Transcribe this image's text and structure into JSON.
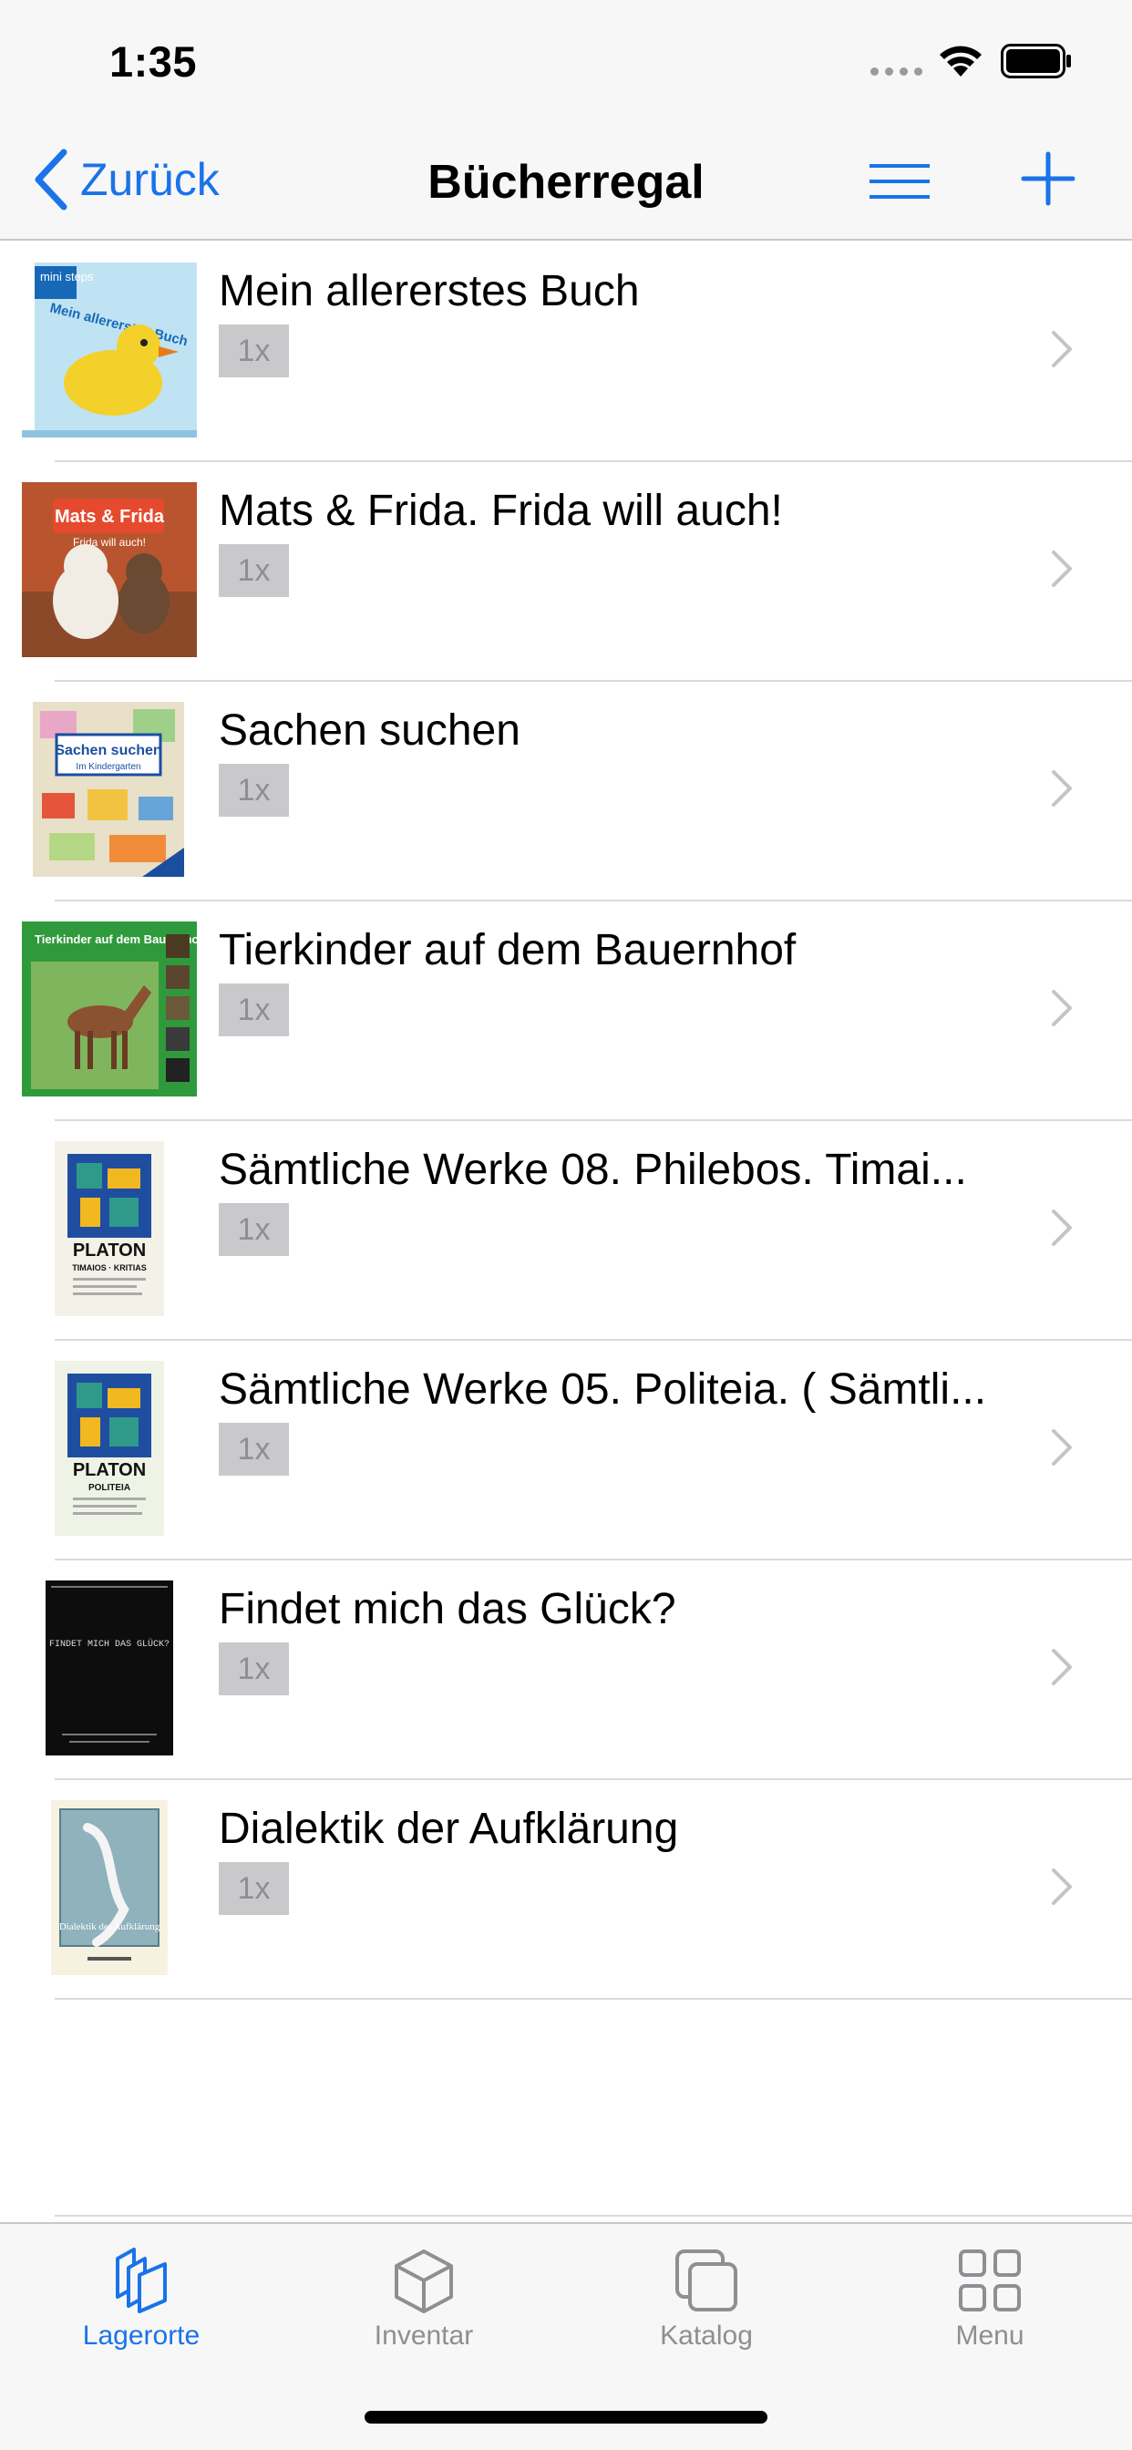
{
  "status_bar": {
    "time": "1:35"
  },
  "nav": {
    "back_label": "Zurück",
    "title": "Bücherregal"
  },
  "books": [
    {
      "title": "Mein allererstes Buch",
      "quantity": "1x",
      "cover_text": "Mein allererstes Buch",
      "cover_badge": "mini steps"
    },
    {
      "title": "Mats & Frida. Frida will auch!",
      "quantity": "1x",
      "cover_text": "Mats & Frida",
      "cover_sub": "Frida will auch!"
    },
    {
      "title": "Sachen suchen",
      "quantity": "1x",
      "cover_text": "Sachen suchen",
      "cover_sub": "Im Kindergarten"
    },
    {
      "title": "Tierkinder auf dem Bauernhof",
      "quantity": "1x",
      "cover_text": "Tierkinder auf dem Bauernhof"
    },
    {
      "title": "Sämtliche Werke 08. Philebos. Timai...",
      "quantity": "1x",
      "cover_text": "PLATON",
      "cover_sub": "TIMAIOS · KRITIAS"
    },
    {
      "title": "Sämtliche Werke 05. Politeia. ( Sämtli...",
      "quantity": "1x",
      "cover_text": "PLATON",
      "cover_sub": "POLITEIA"
    },
    {
      "title": "Findet mich das Glück?",
      "quantity": "1x",
      "cover_text": "FINDET MICH DAS GLÜCK?"
    },
    {
      "title": "Dialektik der Aufklärung",
      "quantity": "1x",
      "cover_text": "Dialektik der Aufklärung"
    }
  ],
  "tabs": [
    {
      "label": "Lagerorte",
      "active": true
    },
    {
      "label": "Inventar",
      "active": false
    },
    {
      "label": "Katalog",
      "active": false
    },
    {
      "label": "Menu",
      "active": false
    }
  ],
  "colors": {
    "accent": "#1a73e8",
    "inactive": "#8e8e93",
    "bar_bg": "#f7f7f7"
  }
}
